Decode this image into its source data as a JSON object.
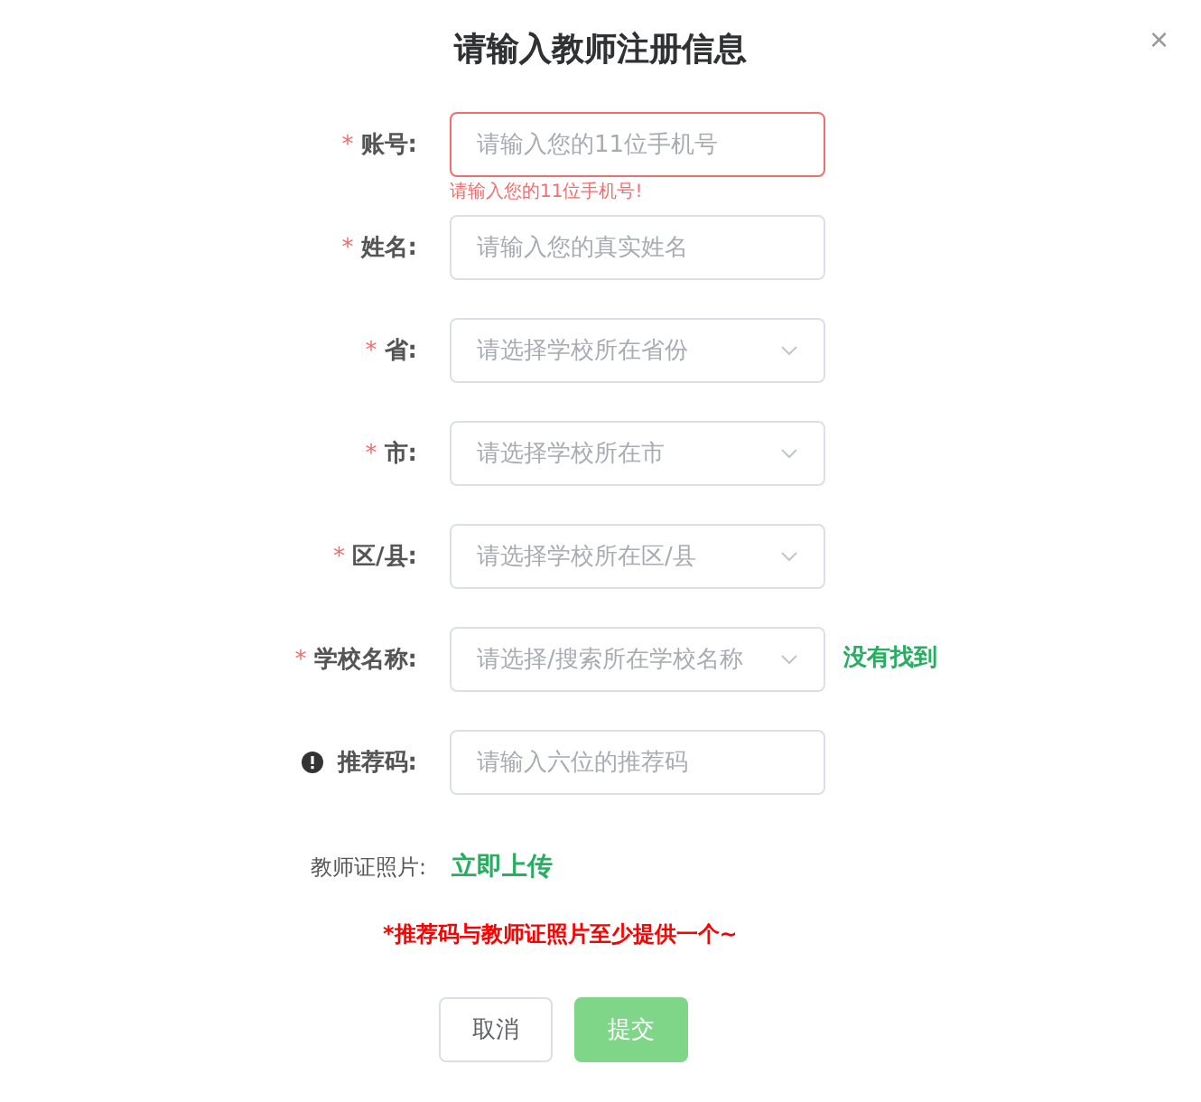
{
  "dialog": {
    "title": "请输入教师注册信息",
    "close": "×"
  },
  "fields": [
    {
      "kind": "input",
      "label": "账号:",
      "marker": {
        "kind": "required",
        "text": "*"
      },
      "placeholder": "请输入您的11位手机号",
      "error": "请输入您的11位手机号!"
    },
    {
      "kind": "input",
      "label": "姓名:",
      "marker": {
        "kind": "required",
        "text": "*"
      },
      "placeholder": "请输入您的真实姓名"
    },
    {
      "kind": "select",
      "label": "省:",
      "marker": {
        "kind": "required",
        "text": "*"
      },
      "placeholder": "请选择学校所在省份"
    },
    {
      "kind": "select",
      "label": "市:",
      "marker": {
        "kind": "required",
        "text": "*"
      },
      "placeholder": "请选择学校所在市"
    },
    {
      "kind": "select",
      "label": "区/县:",
      "marker": {
        "kind": "required",
        "text": "*"
      },
      "placeholder": "请选择学校所在区/县"
    },
    {
      "kind": "select",
      "label": "学校名称:",
      "marker": {
        "kind": "required",
        "text": "*"
      },
      "placeholder": "请选择/搜索所在学校名称",
      "link": "没有找到"
    },
    {
      "kind": "input",
      "label": "推荐码:",
      "marker": {
        "kind": "info"
      },
      "placeholder": "请输入六位的推荐码"
    }
  ],
  "upload": {
    "label": "教师证照片:",
    "link": "立即上传"
  },
  "note": "*推荐码与教师证照片至少提供一个~",
  "buttons": [
    {
      "label": "取消",
      "kind": "default",
      "disabled": false
    },
    {
      "label": "提交",
      "kind": "primary",
      "disabled": true
    }
  ]
}
